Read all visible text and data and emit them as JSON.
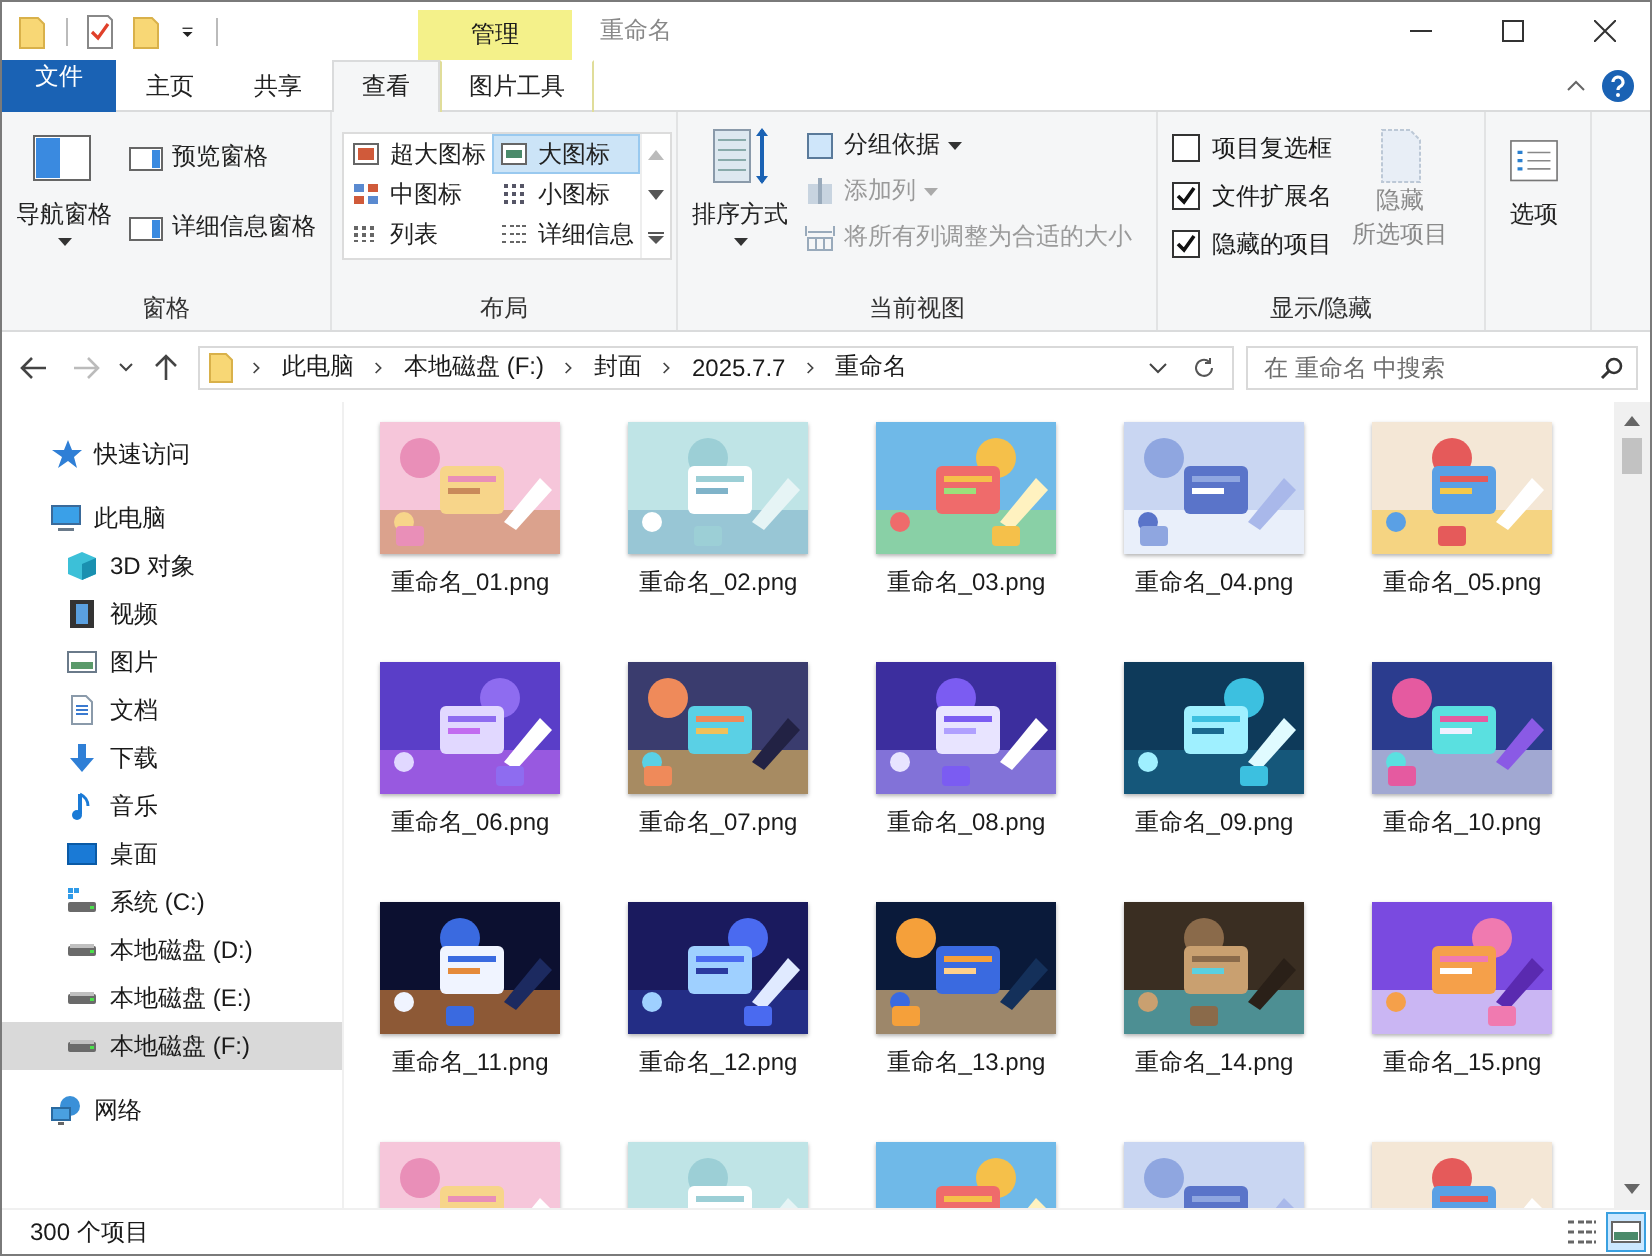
{
  "window": {
    "title": "重命名",
    "context_header": "管理"
  },
  "ribbon_tabs": [
    {
      "label": "文件",
      "kind": "file",
      "selected": false
    },
    {
      "label": "主页",
      "kind": "normal",
      "selected": false
    },
    {
      "label": "共享",
      "kind": "normal",
      "selected": false
    },
    {
      "label": "查看",
      "kind": "normal",
      "selected": true
    },
    {
      "label": "图片工具",
      "kind": "context",
      "selected": false
    }
  ],
  "panes": {
    "label": "窗格",
    "nav_pane": "导航窗格",
    "buttons": [
      "预览窗格",
      "详细信息窗格"
    ]
  },
  "layout": {
    "label": "布局",
    "options": [
      {
        "label": "超大图标",
        "kind": "xl",
        "selected": false
      },
      {
        "label": "大图标",
        "kind": "large",
        "selected": true
      },
      {
        "label": "中图标",
        "kind": "medium",
        "selected": false
      },
      {
        "label": "小图标",
        "kind": "small",
        "selected": false
      },
      {
        "label": "列表",
        "kind": "list",
        "selected": false
      },
      {
        "label": "详细信息",
        "kind": "details",
        "selected": false
      }
    ]
  },
  "current_view": {
    "label": "当前视图",
    "sort": "排序方式",
    "commands": [
      {
        "label": "分组依据",
        "kind": "group",
        "disabled": false,
        "dropdown": true
      },
      {
        "label": "添加列",
        "kind": "add-column",
        "disabled": true,
        "dropdown": true
      },
      {
        "label": "将所有列调整为合适的大小",
        "kind": "fit",
        "disabled": true,
        "dropdown": false
      }
    ]
  },
  "show_hide": {
    "label": "显示/隐藏",
    "checkboxes": [
      {
        "label": "项目复选框",
        "checked": false
      },
      {
        "label": "文件扩展名",
        "checked": true
      },
      {
        "label": "隐藏的项目",
        "checked": true
      }
    ],
    "hide_selected": {
      "lines": [
        "隐藏",
        "所选项目"
      ],
      "disabled": true
    }
  },
  "options": {
    "label": "选项"
  },
  "address_bar": {
    "crumbs": [
      "此电脑",
      "本地磁盘 (F:)",
      "封面",
      "2025.7.7",
      "重命名"
    ]
  },
  "search": {
    "placeholder": "在 重命名 中搜索"
  },
  "sidebar": {
    "items": [
      {
        "label": "快速访问",
        "kind": "star",
        "selected": false
      },
      {
        "label": "此电脑",
        "kind": "pc",
        "selected": false,
        "children": [
          {
            "label": "3D 对象",
            "kind": "cube",
            "selected": false
          },
          {
            "label": "视频",
            "kind": "video",
            "selected": false
          },
          {
            "label": "图片",
            "kind": "picture",
            "selected": false
          },
          {
            "label": "文档",
            "kind": "doc",
            "selected": false
          },
          {
            "label": "下载",
            "kind": "download",
            "selected": false
          },
          {
            "label": "音乐",
            "kind": "music",
            "selected": false
          },
          {
            "label": "桌面",
            "kind": "desktop",
            "selected": false
          },
          {
            "label": "系统 (C:)",
            "kind": "system-drive",
            "selected": false
          },
          {
            "label": "本地磁盘 (D:)",
            "kind": "drive",
            "selected": false
          },
          {
            "label": "本地磁盘 (E:)",
            "kind": "drive",
            "selected": false
          },
          {
            "label": "本地磁盘 (F:)",
            "kind": "drive",
            "selected": true
          }
        ]
      },
      {
        "label": "网络",
        "kind": "network",
        "selected": false
      }
    ]
  },
  "files": [
    {
      "kind": "file",
      "name": "重命名_01.png"
    },
    {
      "kind": "file",
      "name": "重命名_02.png"
    },
    {
      "kind": "file",
      "name": "重命名_03.png"
    },
    {
      "kind": "file",
      "name": "重命名_04.png"
    },
    {
      "kind": "file",
      "name": "重命名_05.png"
    },
    {
      "kind": "file",
      "name": "重命名_06.png"
    },
    {
      "kind": "file",
      "name": "重命名_07.png"
    },
    {
      "kind": "file",
      "name": "重命名_08.png"
    },
    {
      "kind": "file",
      "name": "重命名_09.png"
    },
    {
      "kind": "file",
      "name": "重命名_10.png"
    },
    {
      "kind": "file",
      "name": "重命名_11.png"
    },
    {
      "kind": "file",
      "name": "重命名_12.png"
    },
    {
      "kind": "file",
      "name": "重命名_13.png"
    },
    {
      "kind": "file",
      "name": "重命名_14.png"
    },
    {
      "kind": "file",
      "name": "重命名_15.png"
    },
    {
      "kind": "picture"
    },
    {
      "kind": "picture"
    },
    {
      "kind": "picture"
    },
    {
      "kind": "picture"
    },
    {
      "kind": "picture"
    }
  ],
  "status_bar": {
    "count": "300 个项目",
    "views": [
      {
        "kind": "details",
        "selected": false
      },
      {
        "kind": "large-icons",
        "selected": true
      }
    ]
  }
}
